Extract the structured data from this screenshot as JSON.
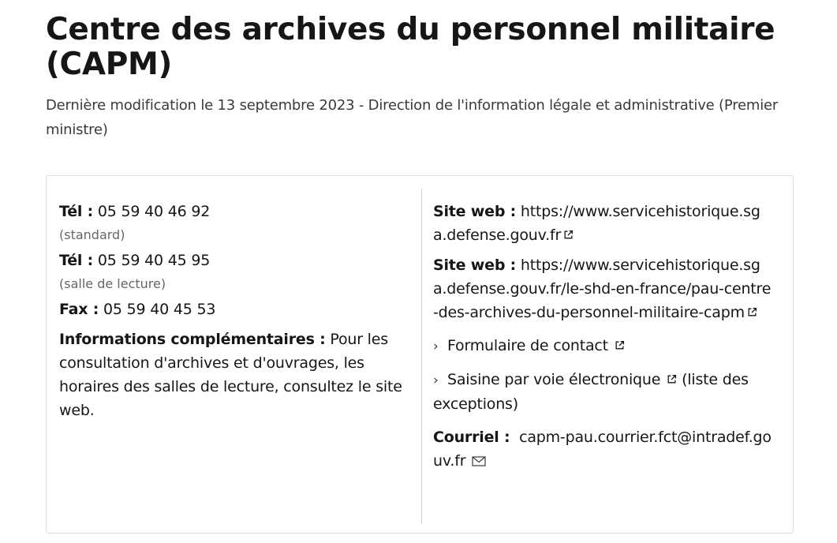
{
  "header": {
    "title": "Centre des archives du personnel militaire (CAPM)",
    "meta": "Dernière modification le 13 septembre 2023 - Direction de l'information légale et administrative (Premier ministre)"
  },
  "contact_left": {
    "tel1_label": "Tél :",
    "tel1_value": "05 59 40 46 92",
    "tel1_note": "(standard)",
    "tel2_label": "Tél :",
    "tel2_value": "05 59 40 45 95",
    "tel2_note": "(salle de lecture)",
    "fax_label": "Fax :",
    "fax_value": "05 59 40 45 53",
    "info_label": "Informations complémentaires :",
    "info_value": "Pour les consultation d'archives et d'ouvrages, les horaires des salles de lecture, consultez le site web."
  },
  "contact_right": {
    "site1_label": "Site web :",
    "site1_url": "https://www.servicehistorique.sga.defense.gouv.fr",
    "site2_label": "Site web :",
    "site2_url": "https://www.servicehistorique.sga.defense.gouv.fr/le-shd-en-france/pau-centre-des-archives-du-personnel-militaire-capm",
    "form_link": "Formulaire de contact",
    "saisine_link": "Saisine par voie électronique",
    "saisine_suffix": "(liste des exceptions)",
    "email_label": "Courriel :",
    "email_value": "capm-pau.courrier.fct@intradef.gouv.fr"
  },
  "icons": {
    "external": "external-link-icon",
    "mail": "envelope-icon",
    "chevron": "chevron-right-icon"
  },
  "colors": {
    "text": "#161616",
    "muted": "#666666",
    "border": "#dddddd"
  }
}
